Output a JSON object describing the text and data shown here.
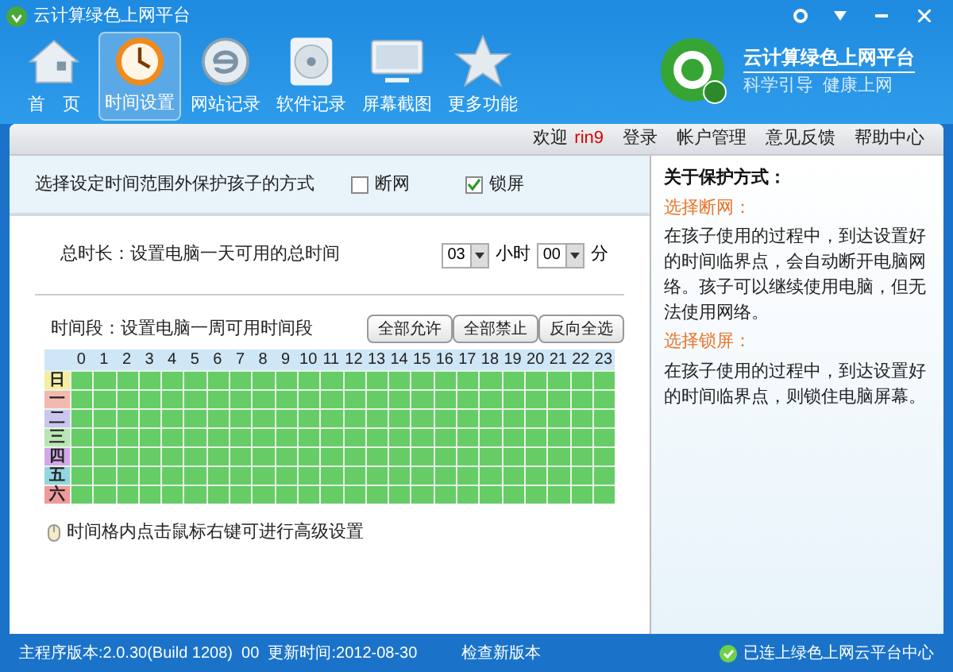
{
  "window": {
    "title": "云计算绿色上网平台"
  },
  "nav": [
    {
      "label": "首　页",
      "selected": false
    },
    {
      "label": "时间设置",
      "selected": true
    },
    {
      "label": "网站记录",
      "selected": false
    },
    {
      "label": "软件记录",
      "selected": false
    },
    {
      "label": "屏幕截图",
      "selected": false
    },
    {
      "label": "更多功能",
      "selected": false
    }
  ],
  "brand": {
    "name": "云计算绿色上网平台",
    "slogan": "科学引导  健康上网"
  },
  "account_bar": {
    "welcome": "欢迎",
    "user": "rin9",
    "links": [
      "登录",
      "帐户管理",
      "意见反馈",
      "帮助中心"
    ]
  },
  "protect_mode": {
    "label": "选择设定时间范围外保护孩子的方式",
    "options": [
      {
        "label": "断网",
        "checked": false
      },
      {
        "label": "锁屏",
        "checked": true
      }
    ]
  },
  "total_time": {
    "label": "总时长：设置电脑一天可用的总时间",
    "hours": "03",
    "hours_unit": "小时",
    "minutes": "00",
    "minutes_unit": "分"
  },
  "period": {
    "label": "时间段：设置电脑一周可用时间段",
    "buttons": [
      "全部允许",
      "全部禁止",
      "反向全选"
    ]
  },
  "grid": {
    "hours": [
      "0",
      "1",
      "2",
      "3",
      "4",
      "5",
      "6",
      "7",
      "8",
      "9",
      "10",
      "11",
      "12",
      "13",
      "14",
      "15",
      "16",
      "17",
      "18",
      "19",
      "20",
      "21",
      "22",
      "23"
    ],
    "days": [
      {
        "label": "日",
        "color": "#f3eea0",
        "allowed": [
          true,
          true,
          true,
          true,
          true,
          true,
          true,
          true,
          true,
          true,
          true,
          true,
          true,
          true,
          true,
          true,
          true,
          true,
          true,
          true,
          true,
          true,
          true,
          true
        ]
      },
      {
        "label": "一",
        "color": "#f3b9b0",
        "allowed": [
          true,
          true,
          true,
          true,
          true,
          true,
          true,
          true,
          true,
          true,
          true,
          true,
          true,
          true,
          true,
          true,
          true,
          true,
          true,
          true,
          true,
          true,
          true,
          true
        ]
      },
      {
        "label": "二",
        "color": "#c9c6f0",
        "allowed": [
          true,
          true,
          true,
          true,
          true,
          true,
          true,
          true,
          true,
          true,
          true,
          true,
          true,
          true,
          true,
          true,
          true,
          true,
          true,
          true,
          true,
          true,
          true,
          true
        ]
      },
      {
        "label": "三",
        "color": "#b9e6b4",
        "allowed": [
          true,
          true,
          true,
          true,
          true,
          true,
          true,
          true,
          true,
          true,
          true,
          true,
          true,
          true,
          true,
          true,
          true,
          true,
          true,
          true,
          true,
          true,
          true,
          true
        ]
      },
      {
        "label": "四",
        "color": "#d3a8e6",
        "allowed": [
          true,
          true,
          true,
          true,
          true,
          true,
          true,
          true,
          true,
          true,
          true,
          true,
          true,
          true,
          true,
          true,
          true,
          true,
          true,
          true,
          true,
          true,
          true,
          true
        ]
      },
      {
        "label": "五",
        "color": "#93d6df",
        "allowed": [
          true,
          true,
          true,
          true,
          true,
          true,
          true,
          true,
          true,
          true,
          true,
          true,
          true,
          true,
          true,
          true,
          true,
          true,
          true,
          true,
          true,
          true,
          true,
          true
        ]
      },
      {
        "label": "六",
        "color": "#ee9a9a",
        "allowed": [
          true,
          true,
          true,
          true,
          true,
          true,
          true,
          true,
          true,
          true,
          true,
          true,
          true,
          true,
          true,
          true,
          true,
          true,
          true,
          true,
          true,
          true,
          true,
          true
        ]
      }
    ]
  },
  "hint": "时间格内点击鼠标右键可进行高级设置",
  "info": {
    "title": "关于保护方式：",
    "sections": [
      {
        "heading": "选择断网：",
        "text": "在孩子使用的过程中，到达设置好的时间临界点，会自动断开电脑网络。孩子可以继续使用电脑，但无法使用网络。"
      },
      {
        "heading": "选择锁屏：",
        "text": "在孩子使用的过程中，到达设置好的时间临界点，则锁住电脑屏幕。"
      }
    ]
  },
  "status_bar": {
    "version": "主程序版本:2.0.30(Build 1208)  00  更新时间:2012-08-30",
    "check_update": "检查新版本",
    "connection": "已连上绿色上网云平台中心"
  }
}
